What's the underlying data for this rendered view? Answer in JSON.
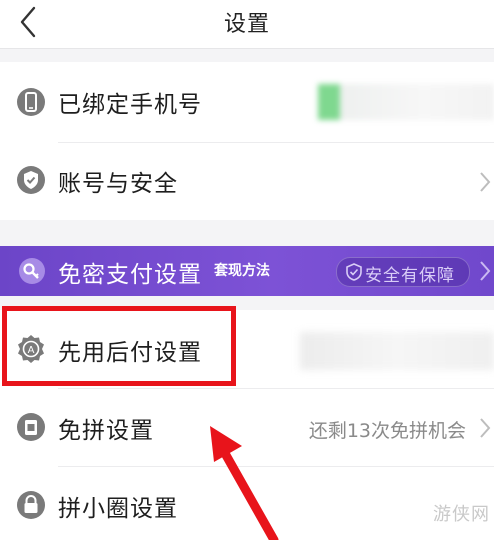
{
  "header": {
    "title": "设置"
  },
  "items": {
    "phone": {
      "label": "已绑定手机号"
    },
    "account": {
      "label": "账号与安全"
    },
    "secret_pay": {
      "label": "免密支付设置",
      "tag": "套现方法",
      "badge": "安全有保障"
    },
    "pay_later": {
      "label": "先用后付设置"
    },
    "free_group": {
      "label": "免拼设置",
      "value": "还剩13次免拼机会"
    },
    "circle": {
      "label": "拼小圈设置"
    }
  },
  "watermark": "游侠网",
  "colors": {
    "banner": "#7d52d6",
    "highlight": "#e8141b",
    "arrow": "#e8141b",
    "icon": "#7a7a7a"
  }
}
